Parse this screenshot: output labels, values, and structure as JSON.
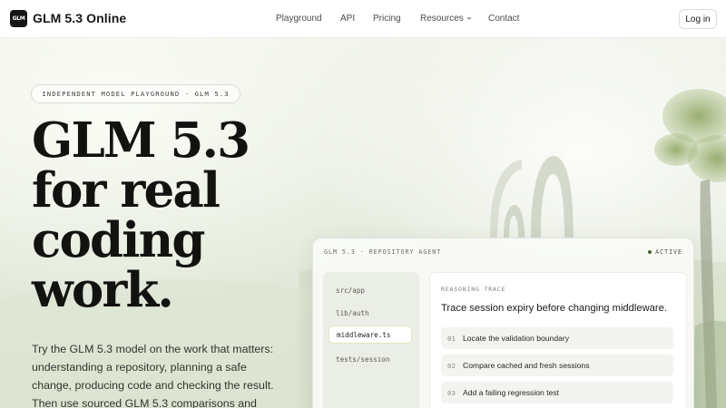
{
  "header": {
    "logo_text": "GLM",
    "brand": "GLM 5.3 Online",
    "nav": [
      {
        "label": "Playground"
      },
      {
        "label": "API"
      },
      {
        "label": "Pricing"
      },
      {
        "label": "Resources"
      },
      {
        "label": "Contact"
      }
    ],
    "login_label": "Log in"
  },
  "hero": {
    "eyebrow": "INDEPENDENT MODEL PLAYGROUND · GLM 5.3",
    "headline_lines": [
      "GLM 5.3",
      "for real",
      "coding",
      "work."
    ],
    "description_lines": [
      "Try the GLM 5.3 model on the work that matters:",
      "understanding a repository, planning a safe",
      "change, producing code and checking the result.",
      "Then use sourced GLM 5.3 comparisons and"
    ]
  },
  "agent_panel": {
    "title": "GLM 5.3 · REPOSITORY AGENT",
    "status": "ACTIVE",
    "status_color": "#3f6a2c",
    "files": [
      {
        "label": "src/app",
        "active": false
      },
      {
        "label": "lib/auth",
        "active": false
      },
      {
        "label": "middleware.ts",
        "active": true
      },
      {
        "label": "tests/session",
        "active": false
      }
    ],
    "trace": {
      "label": "REASONING TRACE",
      "title": "Trace session expiry before changing middleware.",
      "steps": [
        {
          "num": "01",
          "text": "Locate the validation boundary"
        },
        {
          "num": "02",
          "text": "Compare cached and fresh sessions"
        },
        {
          "num": "03",
          "text": "Add a failing regression test"
        }
      ]
    }
  }
}
